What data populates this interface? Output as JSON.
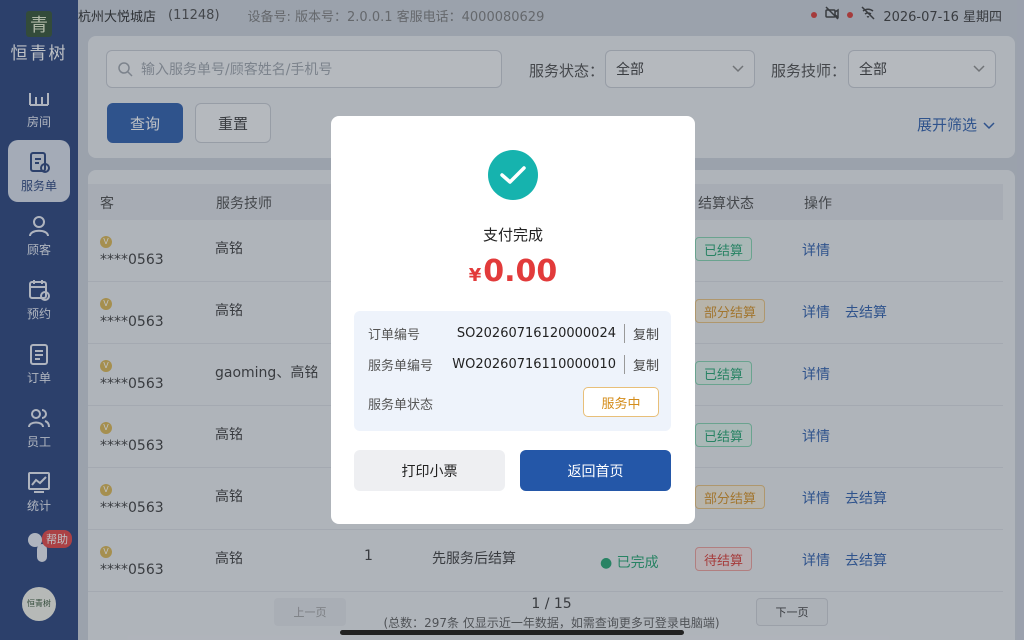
{
  "brand": {
    "logo_char": "青",
    "name": "恒青树",
    "bottom_logo_text": "恒青树"
  },
  "statusbar": {
    "store_name": "杭州大悦城店",
    "store_id": "(11248)",
    "device_info": "设备号: 版本号：2.0.0.1 客服电话：4000080629",
    "datetime": "2026-07-16 星期四"
  },
  "sidebar": {
    "items": [
      {
        "label": "房间",
        "icon": "room-icon"
      },
      {
        "label": "服务单",
        "icon": "service-order-icon",
        "active": true
      },
      {
        "label": "顾客",
        "icon": "customer-icon"
      },
      {
        "label": "预约",
        "icon": "appointment-icon"
      },
      {
        "label": "订单",
        "icon": "order-icon"
      },
      {
        "label": "员工",
        "icon": "staff-icon"
      },
      {
        "label": "统计",
        "icon": "stats-icon"
      }
    ],
    "help_label": "帮助"
  },
  "filter": {
    "search_placeholder": "输入服务单号/顾客姓名/手机号",
    "status_label": "服务状态：",
    "status_value": "全部",
    "tech_label": "服务技师：",
    "tech_value": "全部",
    "query_label": "查询",
    "reset_label": "重置",
    "expand_label": "展开筛选"
  },
  "table": {
    "headers": {
      "tech": "服务技师",
      "settle": "结算状态",
      "ops": "操作"
    },
    "rows": [
      {
        "customer_tail": "****0563",
        "tech": "高铭",
        "settle": "已结算",
        "settle_type": "green",
        "ops": [
          "详情"
        ]
      },
      {
        "customer_tail": "****0563",
        "tech": "高铭",
        "settle": "部分结算",
        "settle_type": "orange",
        "ops": [
          "详情",
          "去结算"
        ]
      },
      {
        "customer_tail": "****0563",
        "tech": "gaoming、高铭",
        "settle": "已结算",
        "settle_type": "green",
        "ops": [
          "详情"
        ]
      },
      {
        "customer_tail": "****0563",
        "tech": "高铭",
        "settle": "已结算",
        "settle_type": "green",
        "ops": [
          "详情"
        ]
      },
      {
        "customer_tail": "****0563",
        "tech": "高铭",
        "settle": "部分结算",
        "settle_type": "orange",
        "ops": [
          "详情",
          "去结算"
        ]
      },
      {
        "customer_tail": "****0563",
        "tech": "高铭",
        "count": "1",
        "mode": "先服务后结算",
        "service_status": "已完成",
        "settle": "待结算",
        "settle_type": "red",
        "ops": [
          "详情",
          "去结算"
        ]
      }
    ]
  },
  "pager": {
    "prev_label": "上一页",
    "next_label": "下一页",
    "current": "1",
    "total_pages": "/ 15",
    "summary": "(总数：297条 仅显示近一年数据，如需查询更多可登录电脑端)"
  },
  "modal": {
    "title": "支付完成",
    "currency": "¥",
    "amount": "0.00",
    "order_no_label": "订单编号",
    "order_no": "SO20260716120000024",
    "service_no_label": "服务单编号",
    "service_no": "WO20260716110000010",
    "copy_label": "复制",
    "status_label": "服务单状态",
    "status_value": "服务中",
    "print_label": "打印小票",
    "home_label": "返回首页",
    "colors": {
      "success": "#16b3ae",
      "amount": "#e23b3b",
      "primary": "#2457a8"
    }
  }
}
